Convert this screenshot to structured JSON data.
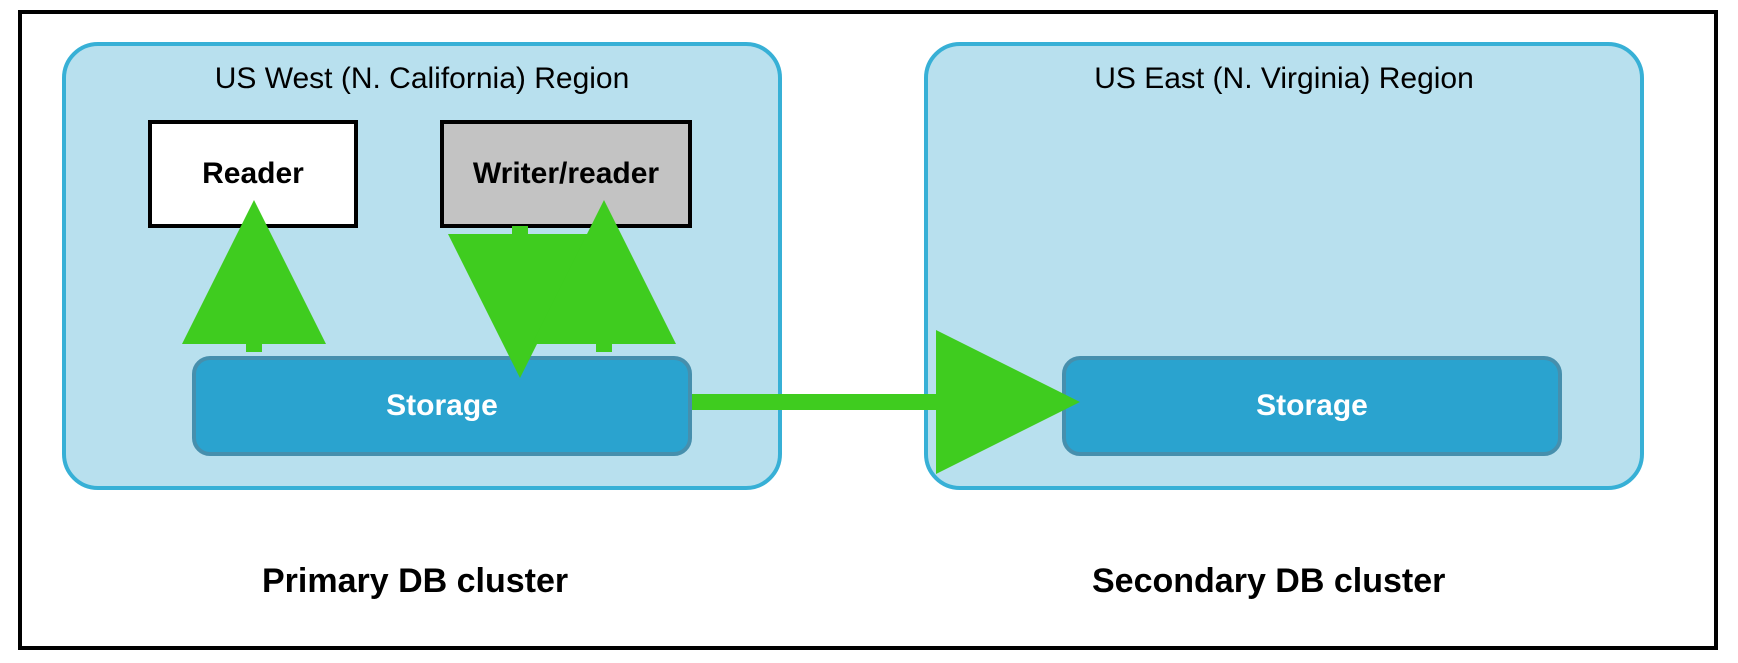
{
  "diagram": {
    "primary": {
      "region_title": "US West (N. California) Region",
      "reader_label": "Reader",
      "writer_label": "Writer/reader",
      "storage_label": "Storage",
      "caption": "Primary DB cluster"
    },
    "secondary": {
      "region_title": "US East (N. Virginia) Region",
      "storage_label": "Storage",
      "caption": "Secondary DB cluster"
    },
    "colors": {
      "region_fill": "#b8e0ee",
      "region_border": "#37b0d6",
      "storage_fill": "#2aa3cf",
      "storage_border": "#468fad",
      "arrow": "#3fcc1f",
      "writer_fill": "#c3c3c3"
    }
  }
}
